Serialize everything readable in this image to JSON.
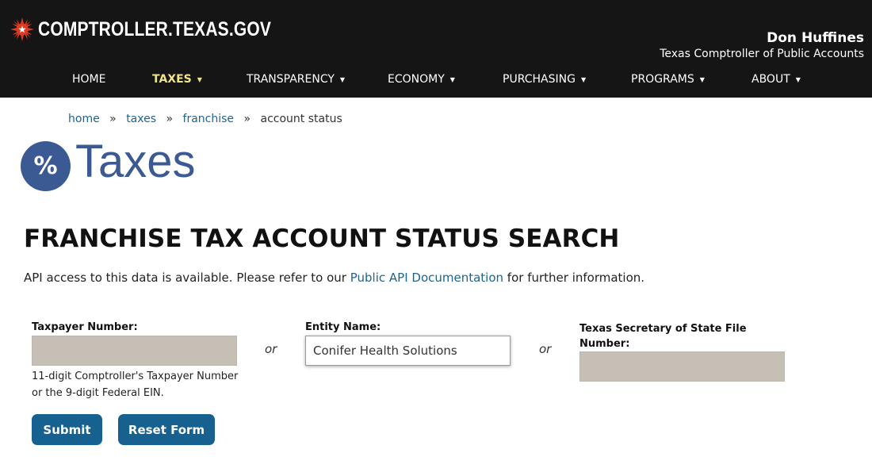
{
  "header": {
    "logo_text": "COMPTROLLER.TEXAS.GOV",
    "logo_icon": "texas-star-icon",
    "official_name": "Don Huffines",
    "official_title": "Texas Comptroller of Public Accounts"
  },
  "nav": {
    "items": [
      {
        "label": "HOME",
        "dropdown": false,
        "active": false
      },
      {
        "label": "TAXES",
        "dropdown": true,
        "active": true
      },
      {
        "label": "TRANSPARENCY",
        "dropdown": true,
        "active": false
      },
      {
        "label": "ECONOMY",
        "dropdown": true,
        "active": false
      },
      {
        "label": "PURCHASING",
        "dropdown": true,
        "active": false
      },
      {
        "label": "PROGRAMS",
        "dropdown": true,
        "active": false
      },
      {
        "label": "ABOUT",
        "dropdown": true,
        "active": false
      }
    ],
    "caret": "▼",
    "active_color": "#f1e58a"
  },
  "breadcrumb": {
    "items": [
      "home",
      "taxes",
      "franchise"
    ],
    "separator": "»",
    "current": "account status"
  },
  "section": {
    "icon_text": "%",
    "icon": "percent-icon",
    "title": "Taxes"
  },
  "page": {
    "title": "FRANCHISE TAX ACCOUNT STATUS SEARCH",
    "intro_before": "API access to this data is available. Please refer to our ",
    "intro_link": "Public API Documentation",
    "intro_after": " for further information."
  },
  "form": {
    "taxpayer_label": "Taxpayer Number:",
    "taxpayer_value": "",
    "taxpayer_help_line1": "11-digit Comptroller's Taxpayer Number",
    "taxpayer_help_line2": "or the 9-digit Federal EIN.",
    "or_text": "or",
    "entity_label": "Entity Name:",
    "entity_value": "Conifer Health Solutions",
    "sos_label_line1": "Texas Secretary of State File",
    "sos_label_line2": "Number:",
    "sos_value": "",
    "submit_label": "Submit",
    "reset_label": "Reset Form"
  },
  "colors": {
    "header_bg": "#151515",
    "brand_blue": "#3b5a93",
    "link_blue": "#1c6591",
    "button_blue": "#176191",
    "input_disabled_bg": "#c5bfb6"
  }
}
